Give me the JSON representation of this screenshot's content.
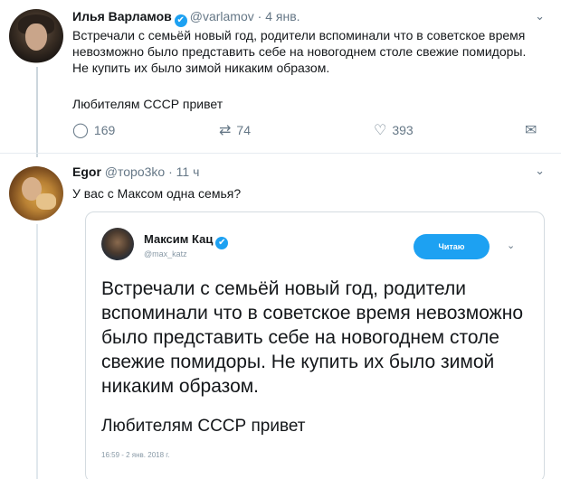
{
  "tweets": [
    {
      "author_name": "Илья Варламов",
      "handle": "@varlamov",
      "separator": "·",
      "date": "4 янв.",
      "text_main": "Встречали с семьёй новый год, родители вспоминали что в советское время невозможно было представить себе на новогоднем столе свежие помидоры. Не купить их было зимой никаким образом.",
      "text_tail": "Любителям СССР привет",
      "replies": "169",
      "retweets": "74",
      "likes": "393"
    },
    {
      "author_name": "Egor",
      "handle": "@торо3ko",
      "separator": "·",
      "date": "11 ч",
      "text_main": "У вас с Максом одна семья?"
    }
  ],
  "quoted": {
    "author_name": "Максим Кац",
    "handle": "@max_katz",
    "follow_label": "Читаю",
    "text_main": "Встречали с семьёй новый год, родители вспоминали что в советское время невозможно было представить себе на новогоднем столе свежие помидоры. Не купить их было зимой никаким образом.",
    "text_tail": "Любителям СССР привет",
    "timestamp": "16:59 - 2 янв. 2018 г."
  },
  "icons": {
    "verified": "✔",
    "chevron": "⌄",
    "reply": "◯",
    "retweet": "⇄",
    "like": "♡",
    "dm": "✉"
  },
  "colors": {
    "accent": "#1da1f2",
    "muted": "#657786",
    "text": "#14171a"
  }
}
